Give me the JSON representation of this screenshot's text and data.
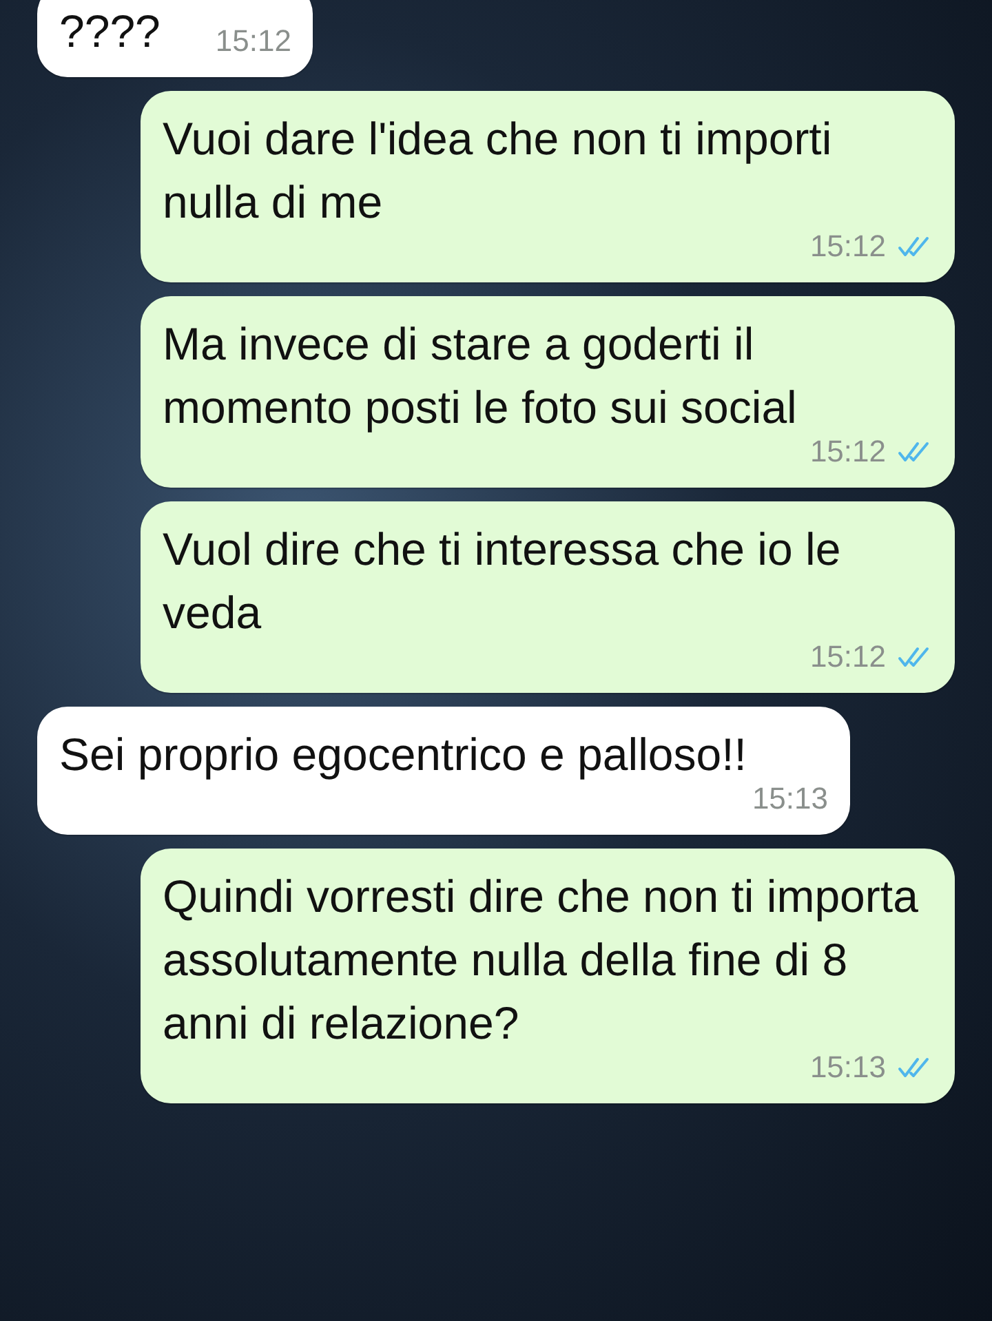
{
  "messages": [
    {
      "kind": "incoming",
      "text": "????",
      "time": "15:12"
    },
    {
      "kind": "outgoing",
      "text": "Vuoi dare l'idea che non ti importi nulla di me",
      "time": "15:12",
      "read": true
    },
    {
      "kind": "outgoing",
      "text": "Ma invece di stare a goderti il momento posti le foto sui social",
      "time": "15:12",
      "read": true
    },
    {
      "kind": "outgoing",
      "text": "Vuol dire che ti interessa che io le veda",
      "time": "15:12",
      "read": true
    },
    {
      "kind": "incoming",
      "text": "Sei proprio egocentrico e palloso!!",
      "time": "15:13"
    },
    {
      "kind": "outgoing",
      "text": "Quindi vorresti dire che non ti importa assolutamente nulla della fine di 8 anni di relazione?",
      "time": "15:13",
      "read": true
    }
  ]
}
